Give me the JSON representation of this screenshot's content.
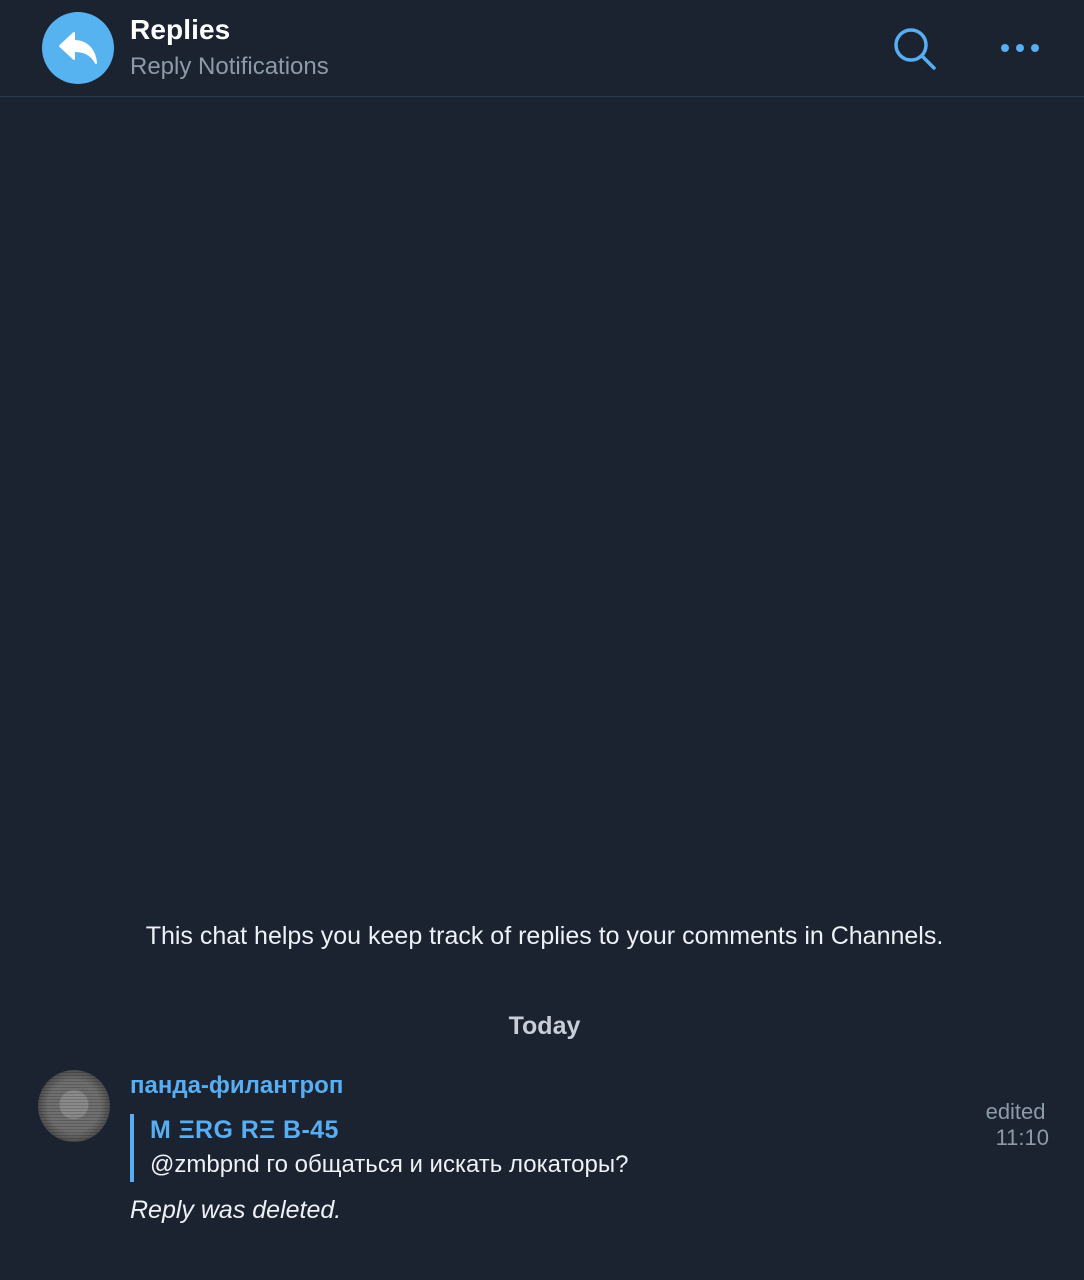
{
  "header": {
    "title": "Replies",
    "subtitle": "Reply Notifications",
    "accent_color": "#57b2f0",
    "icons": [
      "reply-arrow-icon",
      "search-icon",
      "more-icon"
    ]
  },
  "chat": {
    "info_text": "This chat helps you keep track of replies to your comments in Channels.",
    "date_divider": "Today"
  },
  "message": {
    "sender": "панда-филантроп",
    "edited_label": "edited",
    "time": "11:10",
    "quote": {
      "author": "M ΞRG RΞ B-45",
      "text": "@zmbpnd го общаться и искать локаторы?"
    },
    "status": "Reply was deleted."
  }
}
